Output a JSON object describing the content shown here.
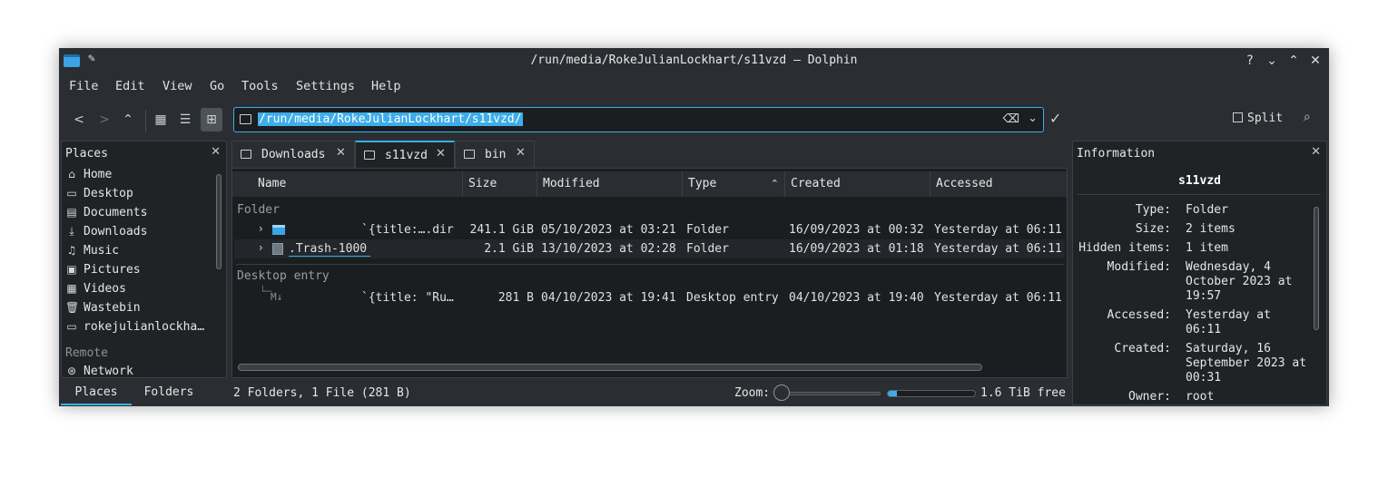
{
  "window": {
    "title": "/run/media/RokeJulianLockhart/s11vzd — Dolphin"
  },
  "menu": [
    "File",
    "Edit",
    "View",
    "Go",
    "Tools",
    "Settings",
    "Help"
  ],
  "toolbar": {
    "location": "/run/media/RokeJulianLockhart/s11vzd/",
    "split_label": "Split"
  },
  "places": {
    "title": "Places",
    "items": [
      {
        "label": "Home",
        "icon": "home-icon",
        "glyph": "⌂"
      },
      {
        "label": "Desktop",
        "icon": "desktop-icon",
        "glyph": "▭"
      },
      {
        "label": "Documents",
        "icon": "documents-icon",
        "glyph": "▤"
      },
      {
        "label": "Downloads",
        "icon": "downloads-icon",
        "glyph": "⤓"
      },
      {
        "label": "Music",
        "icon": "music-icon",
        "glyph": "♫"
      },
      {
        "label": "Pictures",
        "icon": "pictures-icon",
        "glyph": "▣"
      },
      {
        "label": "Videos",
        "icon": "videos-icon",
        "glyph": "▦"
      },
      {
        "label": "Wastebin",
        "icon": "wastebin-icon",
        "glyph": "🗑"
      },
      {
        "label": "rokejulianlockha…",
        "icon": "folder-icon",
        "glyph": "▭"
      }
    ],
    "remote_section": "Remote",
    "remote_items": [
      {
        "label": "Network",
        "icon": "network-icon",
        "glyph": "⊛"
      }
    ]
  },
  "bottom_tabs": [
    "Places",
    "Folders"
  ],
  "tabs": [
    {
      "label": "Downloads"
    },
    {
      "label": "s11vzd"
    },
    {
      "label": "bin"
    }
  ],
  "columns": [
    "Name",
    "Size",
    "Modified",
    "Type",
    "Created",
    "Accessed"
  ],
  "groups": [
    {
      "label": "Folder",
      "rows": [
        {
          "name": "`{title:….dir",
          "size": "241.1 GiB",
          "modified": "05/10/2023 at 03:21",
          "type": "Folder",
          "created": "16/09/2023 at 00:32",
          "accessed": "Yesterday at 06:11"
        },
        {
          "name": ".Trash-1000",
          "size": "2.1 GiB",
          "modified": "13/10/2023 at 02:28",
          "type": "Folder",
          "created": "16/09/2023 at 01:18",
          "accessed": "Yesterday at 06:11"
        }
      ]
    },
    {
      "label": "Desktop entry",
      "rows": [
        {
          "name": "`{title: \"Ru…",
          "size": "281 B",
          "modified": "04/10/2023 at 19:41",
          "type": "Desktop entry",
          "created": "04/10/2023 at 19:40",
          "accessed": "Yesterday at 06:11"
        }
      ]
    }
  ],
  "md_badge": "M↓",
  "status": {
    "summary": "2 Folders, 1 File (281 B)",
    "zoom_label": "Zoom:",
    "free_space": "1.6 TiB free",
    "disk_used_fraction": 0.1
  },
  "info": {
    "title": "Information",
    "name": "s11vzd",
    "fields": [
      {
        "key": "Type:",
        "value": "Folder"
      },
      {
        "key": "Size:",
        "value": "2 items"
      },
      {
        "key": "Hidden items:",
        "value": "1 item"
      },
      {
        "key": "Modified:",
        "value": "Wednesday, 4 October 2023 at 19:57"
      },
      {
        "key": "Accessed:",
        "value": "Yesterday at 06:11"
      },
      {
        "key": "Created:",
        "value": "Saturday, 16 September 2023 at 00:31"
      },
      {
        "key": "Owner:",
        "value": "root"
      }
    ]
  },
  "colors": {
    "accent": "#3daee9",
    "window_bg": "#2a2e32",
    "view_bg": "#1b1e20"
  }
}
